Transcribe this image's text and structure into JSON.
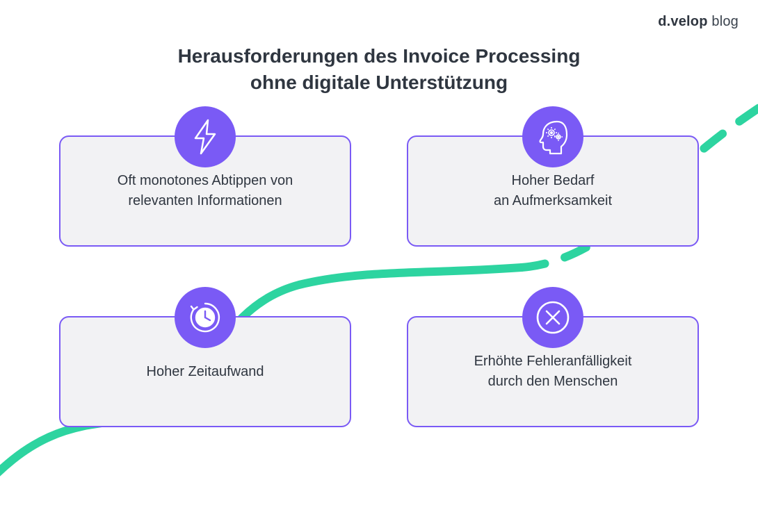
{
  "brand": {
    "strong": "d.velop",
    "light": " blog"
  },
  "title": {
    "line1": "Herausforderungen des Invoice Processing",
    "line2": "ohne digitale Unterstützung"
  },
  "cards": [
    {
      "icon": "lightning-icon",
      "line1": "Oft monotones Abtippen von",
      "line2": "relevanten Informationen"
    },
    {
      "icon": "head-gears-icon",
      "line1": "Hoher Bedarf",
      "line2": "an Aufmerksamkeit"
    },
    {
      "icon": "clock-arrow-icon",
      "line1": "Hoher Zeitaufwand",
      "line2": ""
    },
    {
      "icon": "cross-circle-icon",
      "line1": "Erhöhte Fehleranfälligkeit",
      "line2": "durch den Menschen"
    }
  ],
  "colors": {
    "accent_purple": "#7a5af5",
    "accent_green": "#2dd4a0",
    "card_bg": "#f2f2f4",
    "text": "#2f3640"
  }
}
